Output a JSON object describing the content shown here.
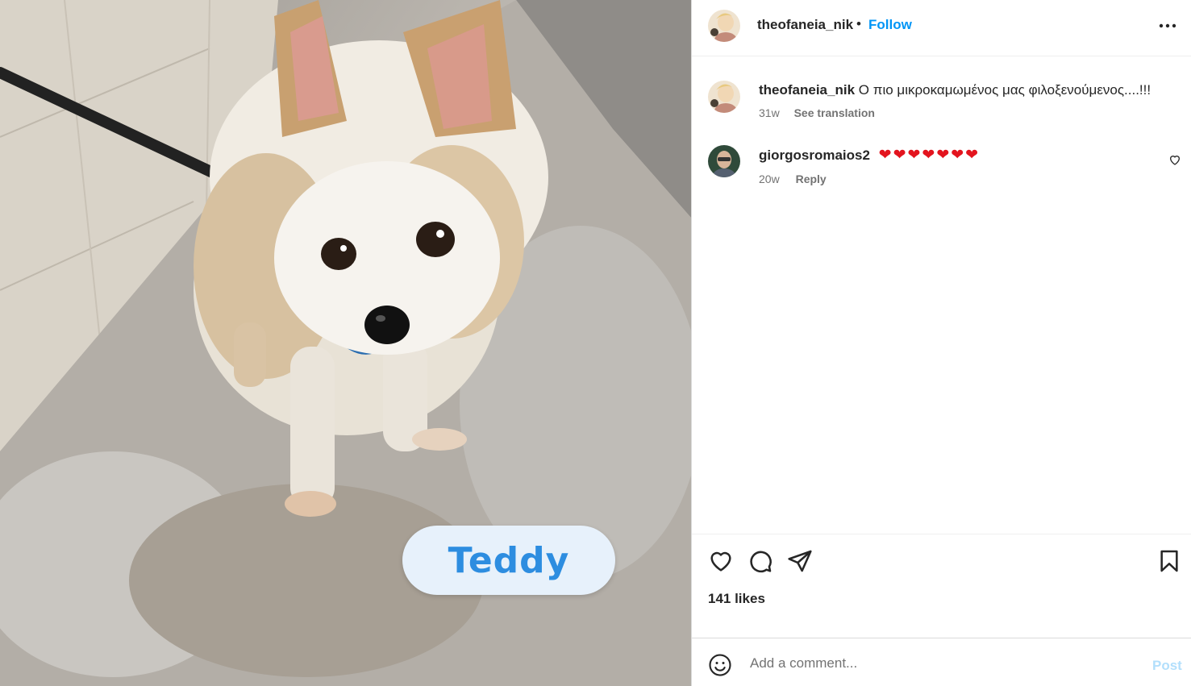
{
  "post": {
    "author": "theofaneia_nik",
    "separator": "•",
    "follow_label": "Follow",
    "more_icon": "more-horizontal-icon",
    "photo_sticker_text": "Teddy"
  },
  "caption": {
    "user": "theofaneia_nik",
    "text": "Ο πιο μικροκαμωμένος μας φιλοξενούμενος....!!!",
    "age": "31w",
    "see_translation": "See translation"
  },
  "comments": [
    {
      "user": "giorgosromaios2",
      "text": "❤❤❤❤❤❤❤",
      "age": "20w",
      "reply_label": "Reply"
    }
  ],
  "actions": {
    "like_icon": "heart-icon",
    "comment_icon": "comment-icon",
    "share_icon": "send-icon",
    "save_icon": "bookmark-icon",
    "likes_text": "141 likes"
  },
  "composer": {
    "emoji_icon": "emoji-icon",
    "placeholder": "Add a comment...",
    "post_label": "Post"
  },
  "colors": {
    "accent": "#0095f6",
    "post_disabled": "#b2dffc",
    "heart": "#e3141e",
    "sticker_text": "#2d8de0",
    "sticker_bg": "#e7f1fb"
  }
}
